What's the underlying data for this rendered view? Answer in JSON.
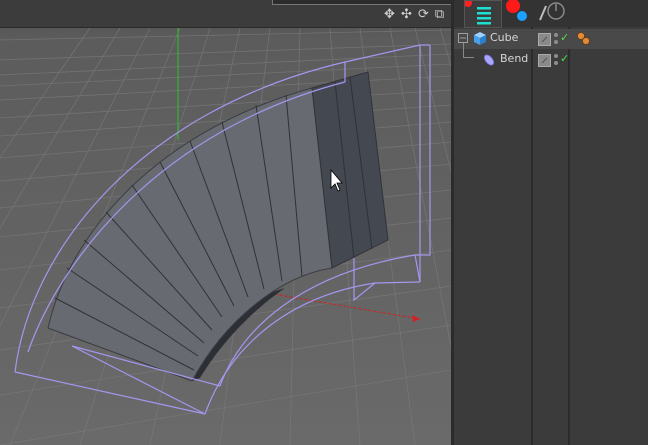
{
  "viewport": {
    "nav_icons": [
      "move-view-icon",
      "zoom-view-icon",
      "rotate-view-icon",
      "maximize-view-icon"
    ],
    "nav_glyphs": [
      "✥",
      "✣",
      "⟳",
      "⧉"
    ]
  },
  "object_manager": {
    "tabs": [
      "objects-tab-icon",
      "layers-tab-icon",
      "properties-tab-icon"
    ],
    "objects": [
      {
        "label": "Cube",
        "icon": "cube-icon",
        "visible_editor": "gray",
        "visible_render": "gray",
        "enabled": "✓",
        "tag": "phong-tag-icon",
        "selected": true
      },
      {
        "label": "Bend",
        "icon": "bend-deformer-icon",
        "visible_editor": "gray",
        "visible_render": "gray",
        "enabled": "✓",
        "selected": false
      }
    ]
  },
  "colors": {
    "bounding_box": "#a596ee",
    "y_axis": "#29c429",
    "x_axis": "#d42020",
    "mesh_face": "#6a6e74",
    "mesh_dark": "#3c4047",
    "check": "#4ce04c"
  }
}
